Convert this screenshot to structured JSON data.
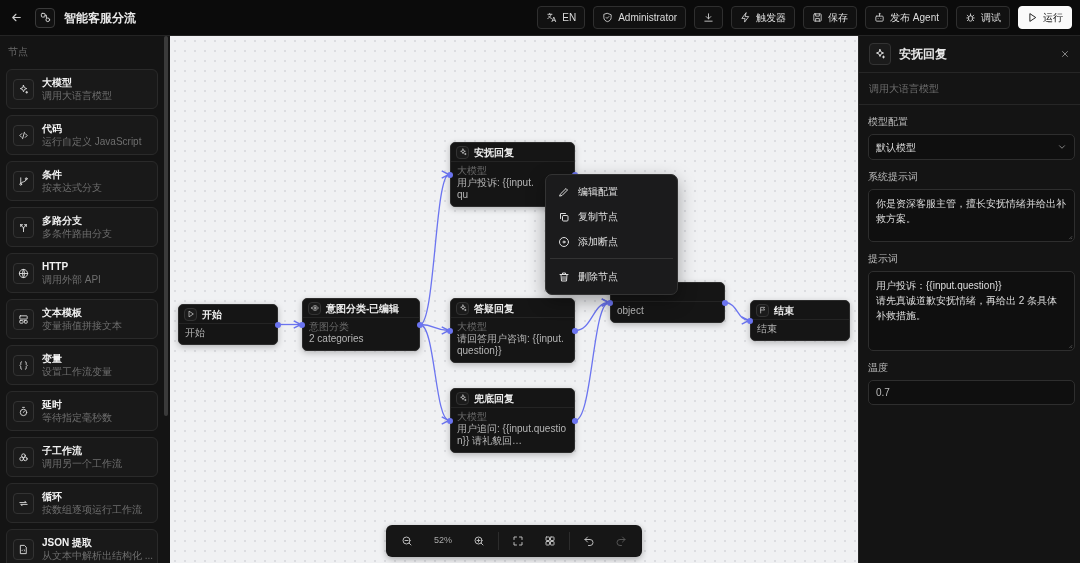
{
  "header": {
    "title": "智能客服分流",
    "buttons": [
      {
        "label": "EN",
        "kind": "outline"
      },
      {
        "label": "Administrator",
        "kind": "outline"
      },
      {
        "kind": "outline"
      },
      {
        "label": "触发器",
        "kind": "outline"
      },
      {
        "label": "保存",
        "kind": "outline"
      },
      {
        "label": "发布 Agent",
        "kind": "outline"
      },
      {
        "label": "调试",
        "kind": "outline"
      },
      {
        "label": "运行",
        "kind": "primary"
      }
    ]
  },
  "sidebar": {
    "heading": "节点",
    "items": [
      {
        "title": "大模型",
        "subtitle": "调用大语言模型"
      },
      {
        "title": "代码",
        "subtitle": "运行自定义 JavaScript"
      },
      {
        "title": "条件",
        "subtitle": "按表达式分支"
      },
      {
        "title": "多路分支",
        "subtitle": "多条件路由分支"
      },
      {
        "title": "HTTP",
        "subtitle": "调用外部 API"
      },
      {
        "title": "文本模板",
        "subtitle": "变量插值拼接文本"
      },
      {
        "title": "变量",
        "subtitle": "设置工作流变量"
      },
      {
        "title": "延时",
        "subtitle": "等待指定毫秒数"
      },
      {
        "title": "子工作流",
        "subtitle": "调用另一个工作流"
      },
      {
        "title": "循环",
        "subtitle": "按数组逐项运行工作流"
      },
      {
        "title": "JSON 提取",
        "subtitle": "从文本中解析出结构化 ..."
      }
    ]
  },
  "canvas": {
    "nodes": [
      {
        "title": "开始",
        "summary": "开始"
      },
      {
        "title": "意图分类-已编辑",
        "type_label": "意图分类",
        "summary": "2 categories"
      },
      {
        "title": "安抚回复",
        "type_label": "大模型",
        "summary": "用户投诉: {{input.qu"
      },
      {
        "title": "答疑回复",
        "type_label": "大模型",
        "summary": "请回答用户咨询: {{input.question}}"
      },
      {
        "summary": "object"
      },
      {
        "title": "结束",
        "summary": "结束"
      },
      {
        "title": "兜底回复",
        "type_label": "大模型",
        "summary": "用户追问: {{input.question}} 请礼貌回…"
      }
    ],
    "context_menu": [
      {
        "label": "编辑配置",
        "separated": false
      },
      {
        "label": "复制节点",
        "separated": false
      },
      {
        "label": "添加断点",
        "separated": false
      },
      {
        "label": "删除节点",
        "separated": true
      }
    ],
    "toolbar": {
      "zoom_level": "52%",
      "undo": {
        "disabled": false
      },
      "redo": {
        "disabled": true
      }
    }
  },
  "panel": {
    "title": "安抚回复",
    "subtitle": "调用大语言模型",
    "fields": [
      {
        "label": "模型配置",
        "kind": "select",
        "value": "默认模型"
      },
      {
        "label": "系统提示词",
        "kind": "textarea",
        "value": "你是资深客服主管，擅长安抚情绪并给出补救方案。"
      },
      {
        "label": "提示词",
        "kind": "textarea",
        "value": "用户投诉：{{input.question}}\n请先真诚道歉安抚情绪，再给出 2 条具体补救措施。"
      },
      {
        "label": "温度",
        "kind": "input",
        "value": "0.7"
      }
    ]
  }
}
